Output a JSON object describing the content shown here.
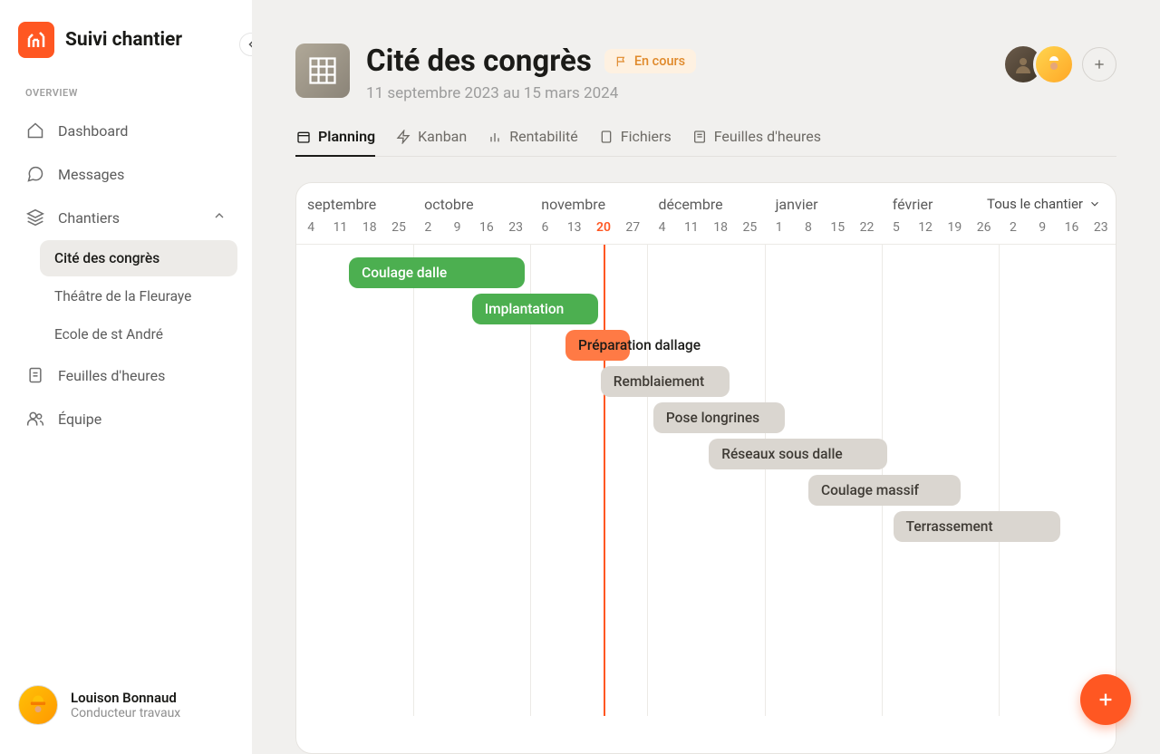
{
  "app_title": "Suivi chantier",
  "section_label": "OVERVIEW",
  "nav": {
    "dashboard": "Dashboard",
    "messages": "Messages",
    "chantiers": "Chantiers",
    "feuilles": "Feuilles d'heures",
    "equipe": "Équipe"
  },
  "chantiers_list": [
    "Cité des congrès",
    "Théâtre de la Fleuraye",
    "Ecole de st André"
  ],
  "active_chantier_index": 0,
  "user": {
    "name": "Louison Bonnaud",
    "role": "Conducteur travaux"
  },
  "project": {
    "title": "Cité des congrès",
    "status": "En cours",
    "dates": "11 septembre 2023 au 15 mars 2024"
  },
  "tabs": {
    "planning": "Planning",
    "kanban": "Kanban",
    "rentabilite": "Rentabilité",
    "fichiers": "Fichiers",
    "feuilles": "Feuilles d'heures"
  },
  "filter_label": "Tous le chantier",
  "colors": {
    "accent": "#FF5722",
    "green": "#4CAF50",
    "grey": "#DAD6D0",
    "orange": "#FF7A45"
  },
  "timeline": {
    "months": [
      {
        "label": "septembre",
        "start_index": 0
      },
      {
        "label": "octobre",
        "start_index": 4
      },
      {
        "label": "novembre",
        "start_index": 8
      },
      {
        "label": "décembre",
        "start_index": 12
      },
      {
        "label": "janvier",
        "start_index": 16
      },
      {
        "label": "février",
        "start_index": 20
      }
    ],
    "days": [
      "4",
      "11",
      "18",
      "25",
      "2",
      "9",
      "16",
      "23",
      "6",
      "13",
      "20",
      "27",
      "4",
      "11",
      "18",
      "25",
      "1",
      "8",
      "15",
      "22",
      "5",
      "12",
      "19",
      "26",
      "2",
      "9",
      "16",
      "23"
    ],
    "today_index": 10,
    "grid_every": 4
  },
  "tasks": [
    {
      "label": "Coulage dalle",
      "start": 1.8,
      "span": 6,
      "color": "green",
      "row": 0
    },
    {
      "label": "Implantation",
      "start": 6,
      "span": 4.3,
      "color": "green",
      "row": 1
    },
    {
      "label": "Préparation dallage",
      "start": 9.2,
      "span": 2.2,
      "color": "orange",
      "row": 2
    },
    {
      "label": "Remblaiement",
      "start": 10.4,
      "span": 4.4,
      "color": "grey",
      "row": 3
    },
    {
      "label": "Pose longrines",
      "start": 12.2,
      "span": 4.5,
      "color": "grey",
      "row": 4
    },
    {
      "label": "Réseaux sous dalle",
      "start": 14.1,
      "span": 6.1,
      "color": "grey",
      "row": 5
    },
    {
      "label": "Coulage massif",
      "start": 17.5,
      "span": 5.2,
      "color": "grey",
      "row": 6
    },
    {
      "label": "Terrassement",
      "start": 20.4,
      "span": 5.7,
      "color": "grey",
      "row": 7
    }
  ]
}
